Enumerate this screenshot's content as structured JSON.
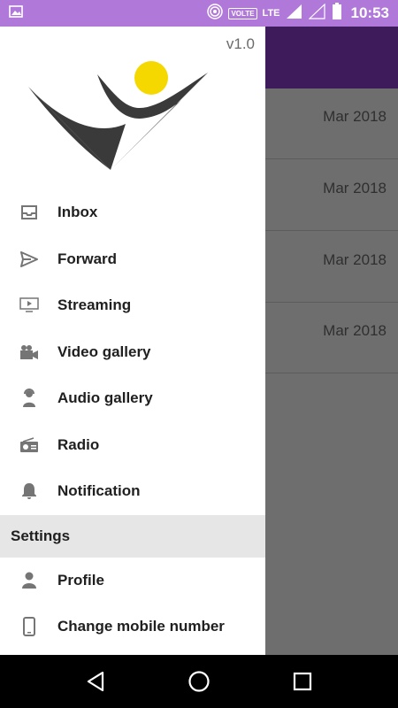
{
  "status_bar": {
    "time": "10:53",
    "volte": "VOLTE",
    "network": "LTE",
    "colors": {
      "background": "#b079d9"
    }
  },
  "drawer": {
    "version": "v1.0",
    "menu": [
      {
        "label": "Inbox",
        "icon": "inbox-icon"
      },
      {
        "label": "Forward",
        "icon": "send-icon"
      },
      {
        "label": "Streaming",
        "icon": "monitor-play-icon"
      },
      {
        "label": "Video gallery",
        "icon": "video-camera-icon"
      },
      {
        "label": "Audio gallery",
        "icon": "headset-person-icon"
      },
      {
        "label": "Radio",
        "icon": "radio-icon"
      },
      {
        "label": "Notification",
        "icon": "bell-icon"
      }
    ],
    "settings_section": {
      "title": "Settings",
      "items": [
        {
          "label": "Profile",
          "icon": "person-icon"
        },
        {
          "label": "Change mobile number",
          "icon": "phone-icon"
        }
      ]
    }
  },
  "background_list": {
    "toolbar_color": "#3e1b5b",
    "rows": [
      {
        "date": "Mar 2018"
      },
      {
        "date": "Mar 2018"
      },
      {
        "date": "Mar 2018"
      },
      {
        "date": "Mar 2018"
      }
    ]
  },
  "nav_bar": {
    "buttons": [
      "back-icon",
      "home-icon",
      "recents-icon"
    ]
  }
}
